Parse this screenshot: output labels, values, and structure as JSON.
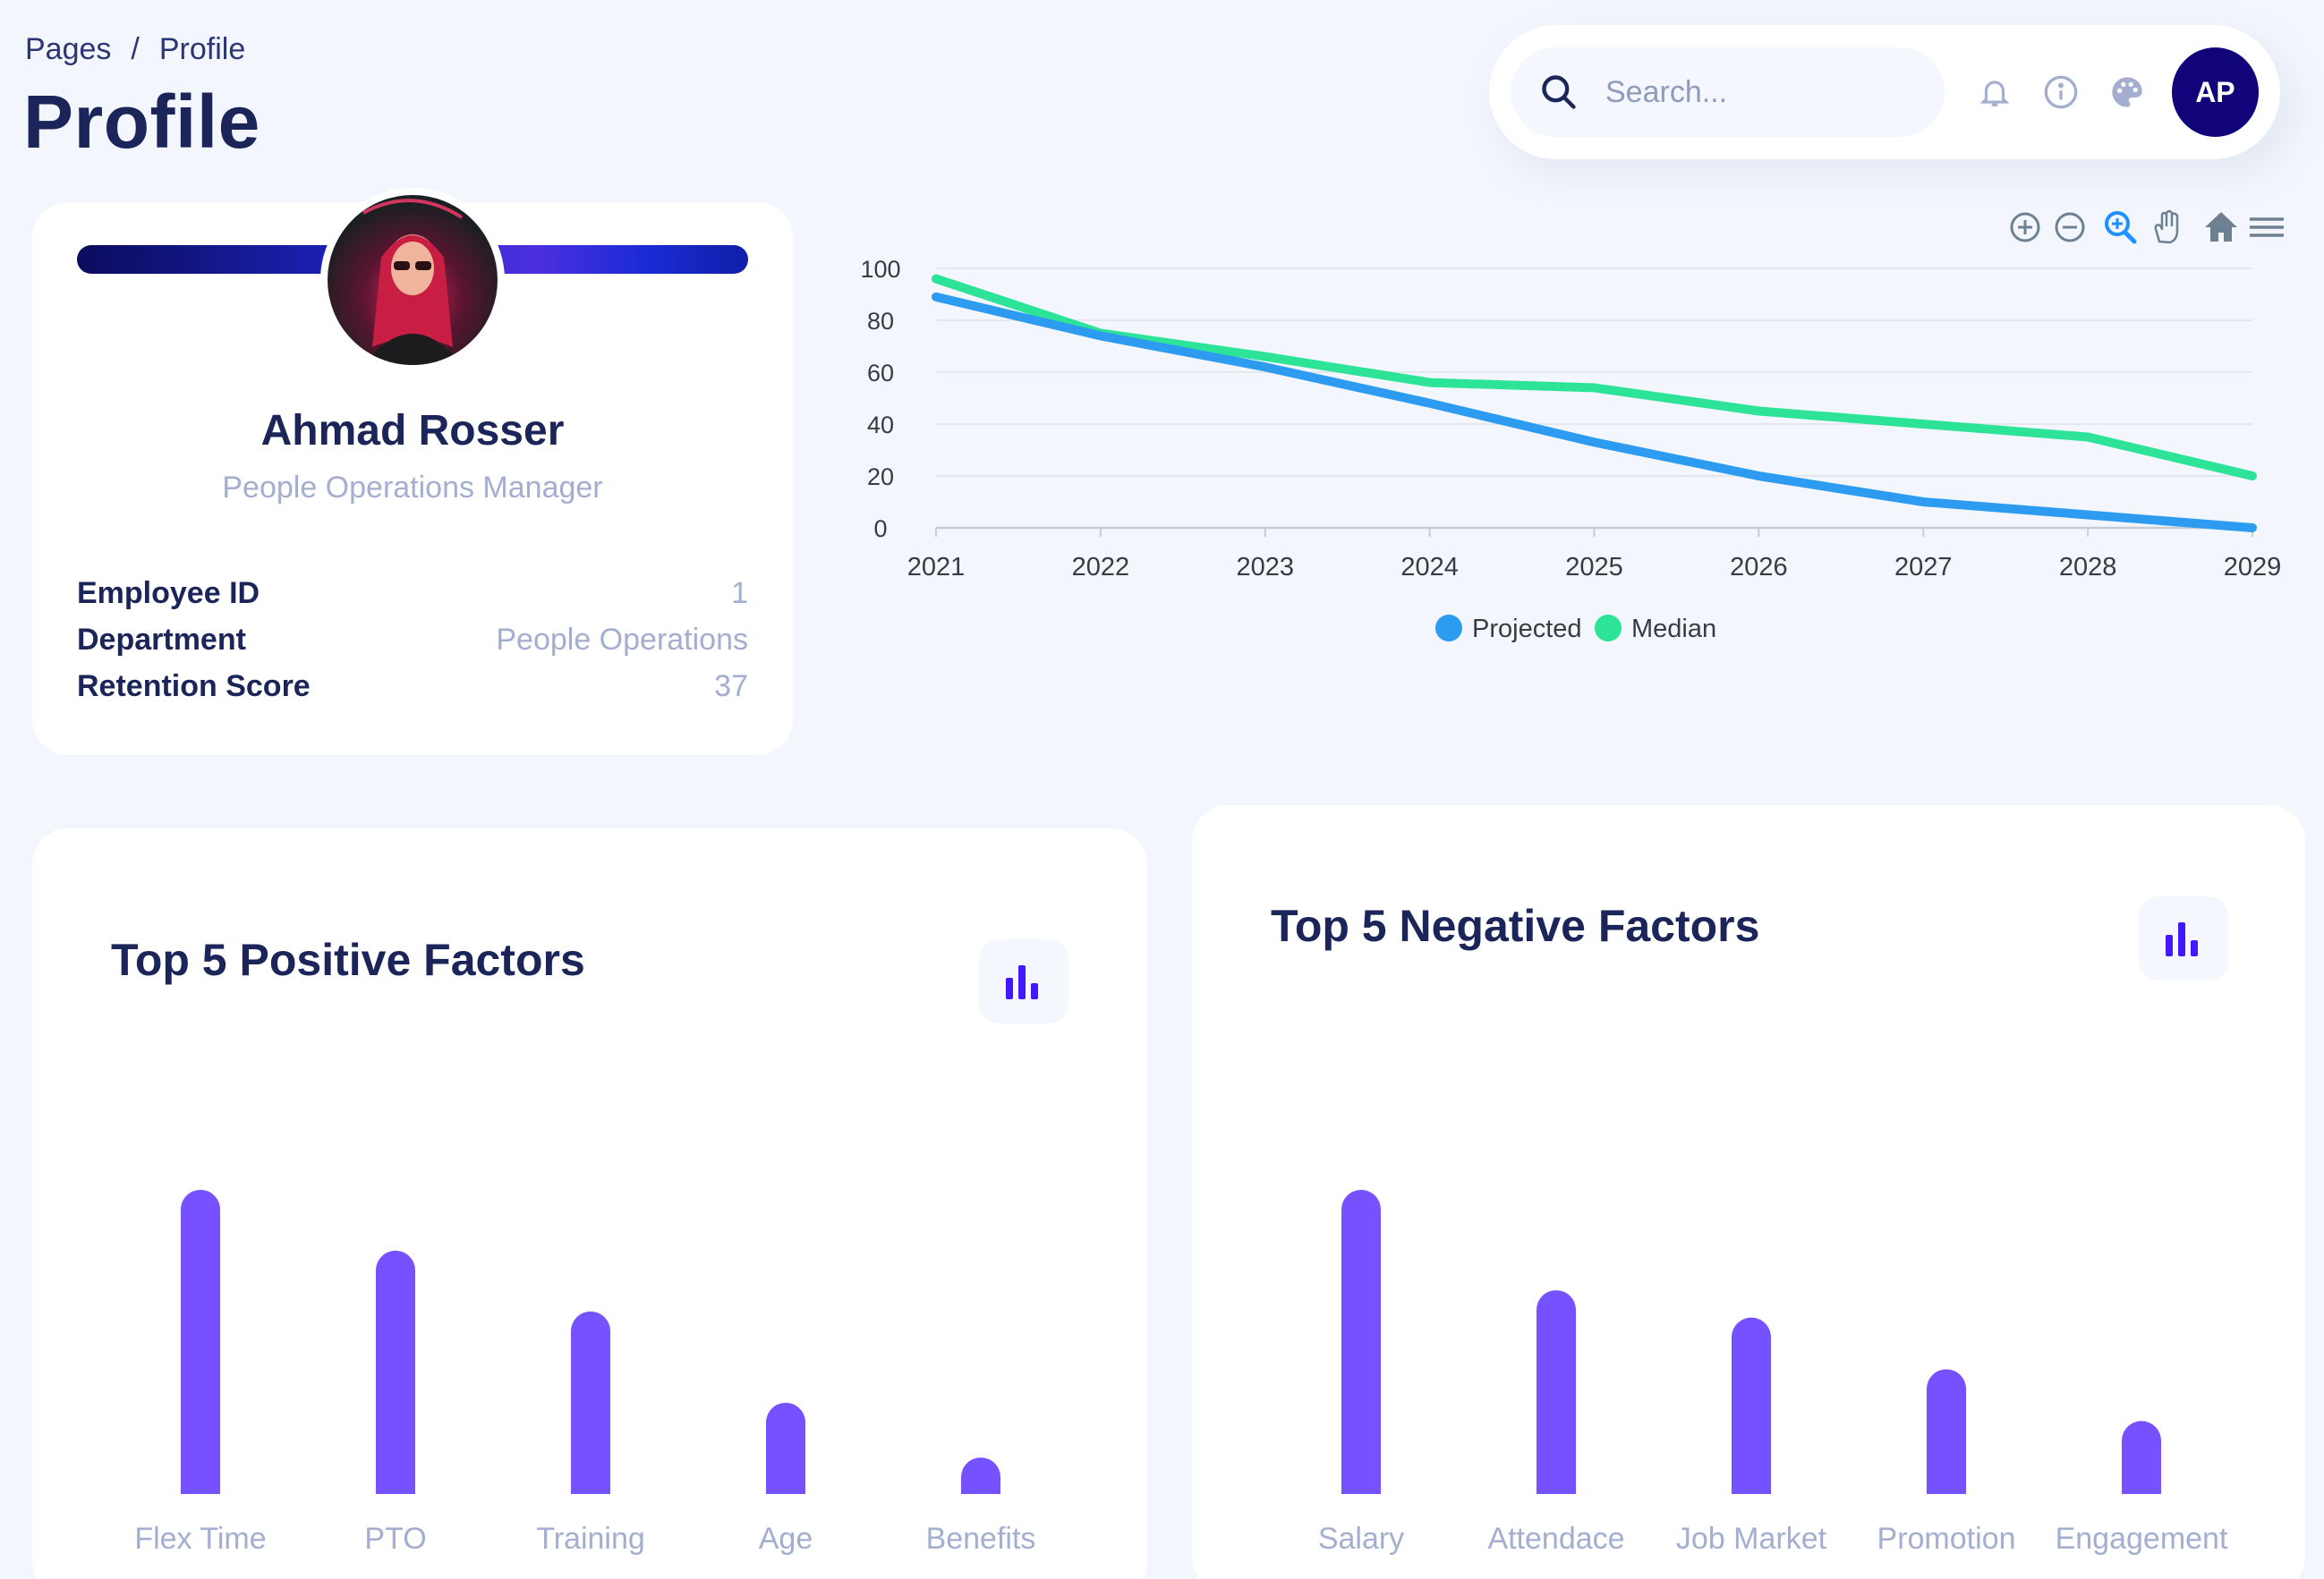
{
  "breadcrumb": {
    "parent": "Pages",
    "separator": "/",
    "current": "Profile"
  },
  "page_title": "Profile",
  "topbar": {
    "search_placeholder": "Search...",
    "icons": [
      "search-icon",
      "bell-icon",
      "info-icon",
      "palette-icon"
    ],
    "avatar_initials": "AP",
    "avatar_color": "#11047a"
  },
  "profile": {
    "name": "Ahmad Rosser",
    "role": "People Operations Manager",
    "fields": [
      {
        "label": "Employee ID",
        "value": "1"
      },
      {
        "label": "Department",
        "value": "People Operations"
      },
      {
        "label": "Retention Score",
        "value": "37"
      }
    ]
  },
  "toolbar_icons": [
    "zoom-in-icon",
    "zoom-out-icon",
    "selection-zoom-icon",
    "pan-icon",
    "home-icon",
    "menu-icon"
  ],
  "chart_data": [
    {
      "type": "line",
      "x": [
        "2021",
        "2022",
        "2023",
        "2024",
        "2025",
        "2026",
        "2027",
        "2028",
        "2029"
      ],
      "ylim": [
        0,
        100
      ],
      "yticks": [
        "0",
        "20",
        "40",
        "60",
        "80",
        "100"
      ],
      "grid": true,
      "legend": "bottom-center",
      "series": [
        {
          "name": "Projected",
          "color": "#2d9cf0",
          "values": [
            89,
            74,
            62,
            48,
            33,
            20,
            10,
            5,
            0
          ]
        },
        {
          "name": "Median",
          "color": "#2de398",
          "values": [
            96,
            75,
            66,
            56,
            54,
            45,
            40,
            35,
            20
          ]
        }
      ]
    },
    {
      "type": "bar",
      "title": "Top 5 Positive Factors",
      "categories": [
        "Flex Time",
        "PTO",
        "Training",
        "Age",
        "Benefits"
      ],
      "values": [
        100,
        80,
        60,
        30,
        12
      ],
      "color": "#7551ff"
    },
    {
      "type": "bar",
      "title": "Top 5 Negative Factors",
      "categories": [
        "Salary",
        "Attendace",
        "Job Market",
        "Promotion",
        "Engagement"
      ],
      "values": [
        100,
        67,
        58,
        41,
        24
      ],
      "color": "#7551ff"
    }
  ]
}
